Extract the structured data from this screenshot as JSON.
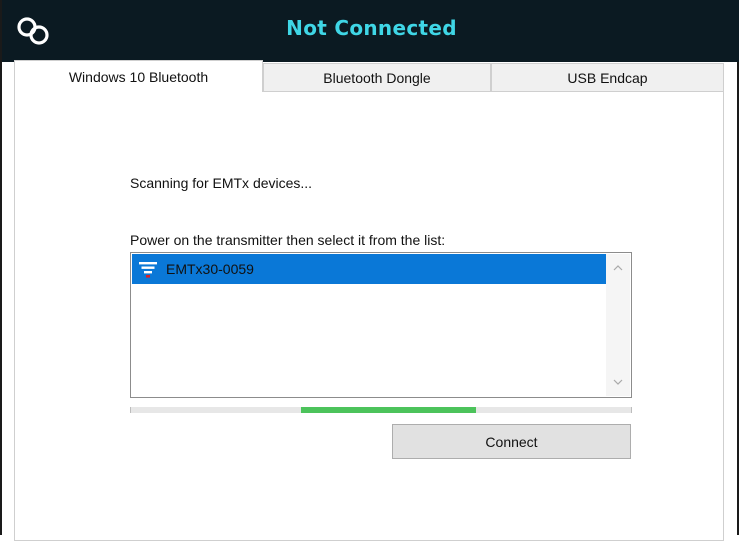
{
  "header": {
    "title": "Not Connected",
    "logo_icon": "chain-link-icon",
    "colors": {
      "background": "#0b1a22",
      "title": "#3fd6e6"
    }
  },
  "tabs": [
    {
      "label": "Windows 10 Bluetooth",
      "active": true
    },
    {
      "label": "Bluetooth Dongle",
      "active": false
    },
    {
      "label": "USB Endcap",
      "active": false
    }
  ],
  "main": {
    "status_text": "Scanning for EMTx devices...",
    "instruction_text": "Power on the transmitter then select it from the list:",
    "devices": [
      {
        "name": "EMTx30-0059",
        "icon": "signal-transmitter-icon",
        "selected": true
      }
    ],
    "scan_progress": {
      "fill_start": 0.34,
      "fill_end": 0.69
    },
    "connect_button": "Connect",
    "colors": {
      "selection": "#0a78d7",
      "progress": "#4cc35b"
    }
  }
}
